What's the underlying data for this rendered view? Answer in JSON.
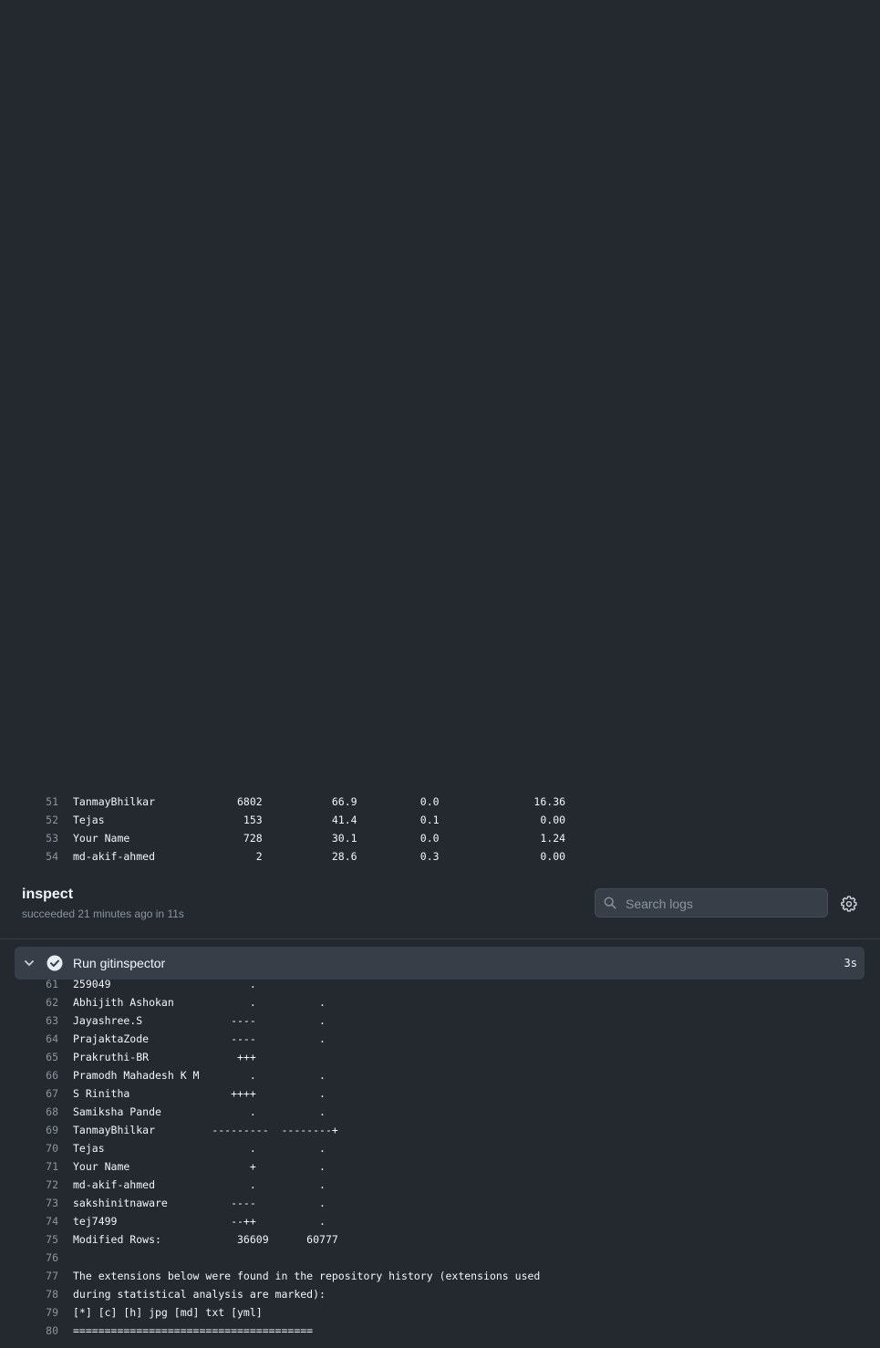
{
  "top_log": [
    {
      "num": "51",
      "text": "TanmayBhilkar             6802           66.9          0.0               16.36"
    },
    {
      "num": "52",
      "text": "Tejas                      153           41.4          0.1                0.00"
    },
    {
      "num": "53",
      "text": "Your Name                  728           30.1          0.0                1.24"
    },
    {
      "num": "54",
      "text": "md-akif-ahmed                2           28.6          0.3                0.00"
    }
  ],
  "job": {
    "title": "inspect",
    "status": "succeeded 21 minutes ago in 11s"
  },
  "search": {
    "placeholder": "Search logs",
    "icon": "search-icon"
  },
  "settings": {
    "icon": "gear-icon"
  },
  "step": {
    "name": "Run gitinspector",
    "duration": "3s",
    "status_icon": "check-circle-icon",
    "expand_icon": "chevron-down-icon"
  },
  "bottom_log": [
    {
      "num": "61",
      "text": "259049                      ."
    },
    {
      "num": "62",
      "text": "Abhijith Ashokan            .          ."
    },
    {
      "num": "63",
      "text": "Jayashree.S              ----          ."
    },
    {
      "num": "64",
      "text": "PrajaktaZode             ----          ."
    },
    {
      "num": "65",
      "text": "Prakruthi-BR              +++"
    },
    {
      "num": "66",
      "text": "Pramodh Mahadesh K M        .          ."
    },
    {
      "num": "67",
      "text": "S Rinitha                ++++          ."
    },
    {
      "num": "68",
      "text": "Samiksha Pande              .          ."
    },
    {
      "num": "69",
      "text": "TanmayBhilkar         ---------  --------+"
    },
    {
      "num": "70",
      "text": "Tejas                       .          ."
    },
    {
      "num": "71",
      "text": "Your Name                   +          ."
    },
    {
      "num": "72",
      "text": "md-akif-ahmed               .          ."
    },
    {
      "num": "73",
      "text": "sakshinitnaware          ----          ."
    },
    {
      "num": "74",
      "text": "tej7499                  --++          ."
    },
    {
      "num": "75",
      "text": "Modified Rows:            36609      60777"
    },
    {
      "num": "76",
      "text": ""
    },
    {
      "num": "77",
      "text": "The extensions below were found in the repository history (extensions used"
    },
    {
      "num": "78",
      "text": "during statistical analysis are marked):"
    },
    {
      "num": "79",
      "text": "[*] [c] [h] jpg [md] txt [yml]"
    },
    {
      "num": "80",
      "text": "======================================"
    }
  ]
}
